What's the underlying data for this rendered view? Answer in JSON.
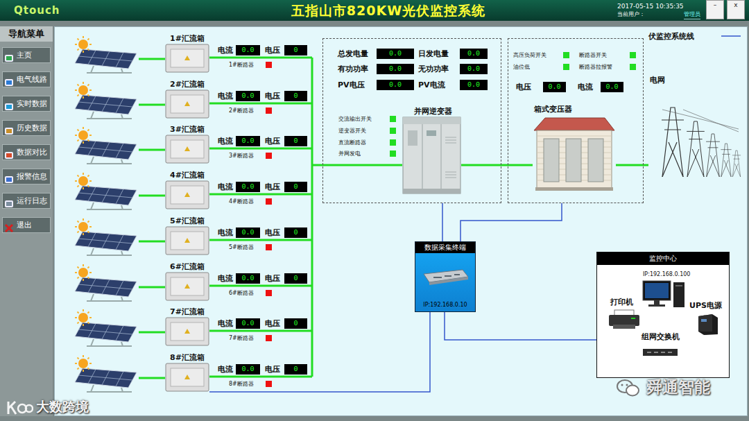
{
  "window": {
    "brand": "Qtouch",
    "title": "五指山市820KW光伏监控系统",
    "datetime": "2017-05-15 10:35:35",
    "user_label": "当前用户：",
    "user": "管理员",
    "controls": [
      "–",
      "x"
    ]
  },
  "sidebar": {
    "title": "导航菜单",
    "items": [
      {
        "label": "主页"
      },
      {
        "label": "电气线路"
      },
      {
        "label": "实时数据"
      },
      {
        "label": "历史数据"
      },
      {
        "label": "数据对比"
      },
      {
        "label": "报警信息"
      },
      {
        "label": "运行日志"
      },
      {
        "label": "退出"
      }
    ]
  },
  "combiners": [
    {
      "name": "1#汇流箱",
      "current_label": "电流",
      "current": "0.0",
      "voltage_label": "电压",
      "voltage": "0",
      "breaker": "1#断路器",
      "breaker_on": false
    },
    {
      "name": "2#汇流箱",
      "current_label": "电流",
      "current": "0.0",
      "voltage_label": "电压",
      "voltage": "0",
      "breaker": "2#断路器",
      "breaker_on": false
    },
    {
      "name": "3#汇流箱",
      "current_label": "电流",
      "current": "0.0",
      "voltage_label": "电压",
      "voltage": "0",
      "breaker": "3#断路器",
      "breaker_on": false
    },
    {
      "name": "4#汇流箱",
      "current_label": "电流",
      "current": "0.0",
      "voltage_label": "电压",
      "voltage": "0",
      "breaker": "4#断路器",
      "breaker_on": false
    },
    {
      "name": "5#汇流箱",
      "current_label": "电流",
      "current": "0.0",
      "voltage_label": "电压",
      "voltage": "0",
      "breaker": "5#断路器",
      "breaker_on": false
    },
    {
      "name": "6#汇流箱",
      "current_label": "电流",
      "current": "0.0",
      "voltage_label": "电压",
      "voltage": "0",
      "breaker": "6#断路器",
      "breaker_on": false
    },
    {
      "name": "7#汇流箱",
      "current_label": "电流",
      "current": "0.0",
      "voltage_label": "电压",
      "voltage": "0",
      "breaker": "7#断路器",
      "breaker_on": false
    },
    {
      "name": "8#汇流箱",
      "current_label": "电流",
      "current": "0.0",
      "voltage_label": "电压",
      "voltage": "0",
      "breaker": "8#断路器",
      "breaker_on": false
    }
  ],
  "inverter": {
    "title": "并网逆变器",
    "readings": [
      {
        "label": "总发电量",
        "value": "0.0"
      },
      {
        "label": "日发电量",
        "value": "0.0"
      },
      {
        "label": "有功功率",
        "value": "0.0"
      },
      {
        "label": "无功功率",
        "value": "0.0"
      },
      {
        "label": "PV电压",
        "value": "0.0"
      },
      {
        "label": "PV电流",
        "value": "0.0"
      }
    ],
    "switches": [
      {
        "label": "交流输出开关",
        "on": true
      },
      {
        "label": "逆变器开关",
        "on": true
      },
      {
        "label": "直流断路器",
        "on": true
      },
      {
        "label": "并网发电",
        "on": true
      }
    ]
  },
  "transformer": {
    "title": "箱式变压器",
    "switches": [
      {
        "label": "高压负荷开关",
        "on": true
      },
      {
        "label": "断路器开关",
        "on": true
      },
      {
        "label": "油位低",
        "on": true
      },
      {
        "label": "断路器拉报警",
        "on": true
      }
    ],
    "readings": [
      {
        "label": "电压",
        "value": "0.0"
      },
      {
        "label": "电流",
        "value": "0.0"
      }
    ]
  },
  "grid": {
    "legend": "伏监控系统线",
    "label": "电网"
  },
  "terminal": {
    "title": "数据采集终端",
    "ip": "IP:192.168.0.10"
  },
  "center": {
    "title": "监控中心",
    "ip": "IP:192.168.0.100",
    "printer": "打印机",
    "ups": "UPS电源",
    "switch": "组网交换机"
  },
  "watermarks": [
    "大数跨境",
    "舜通智能"
  ]
}
